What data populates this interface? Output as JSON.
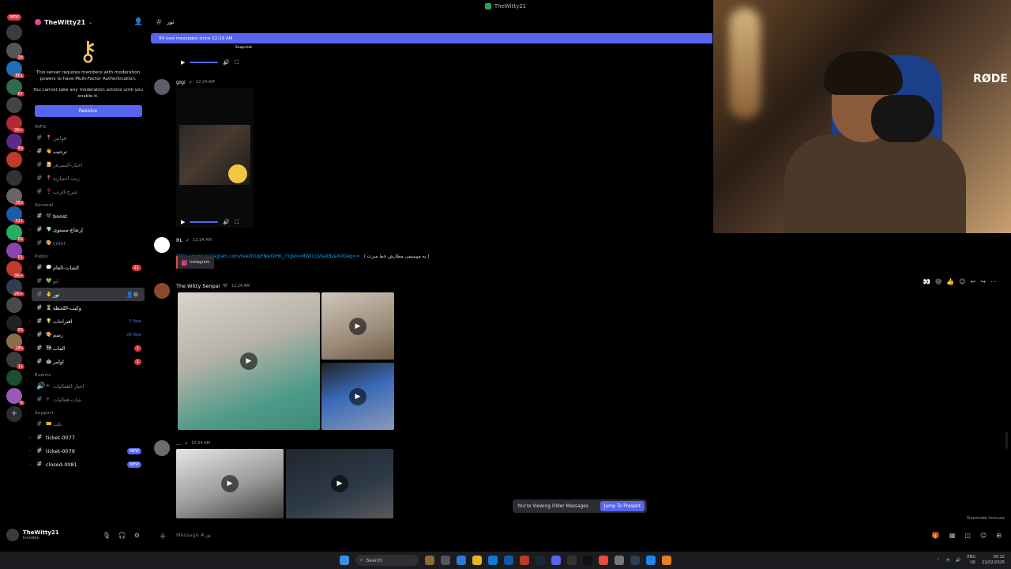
{
  "window": {
    "title": "TheWitty21"
  },
  "rail": {
    "new_label": "NEW",
    "badges": [
      "18",
      "861",
      "67",
      "3K+",
      "89",
      "383",
      "321",
      "83",
      "51",
      "9K+",
      "2K+",
      "55",
      "185",
      "12",
      "6"
    ]
  },
  "server": {
    "name": "TheWitty21",
    "mfa_text_1": "This server requires members with moderation powers to have Multi-Factor Authentication.",
    "mfa_text_2": "You cannot take any moderation actions until you enable it.",
    "resolve_label": "Resolve"
  },
  "categories": {
    "info": "INFO",
    "general": "General",
    "public": "Public",
    "events": "Events",
    "support": "Support"
  },
  "channels": {
    "info": [
      {
        "name": "قوانين",
        "emoji": "📍"
      },
      {
        "name": "ترحيب",
        "emoji": "👋"
      },
      {
        "name": "اخبار-السيرفر",
        "emoji": "📔"
      },
      {
        "name": "رتب-اختيارية",
        "emoji": "📍"
      },
      {
        "name": "شرح-الرتب",
        "emoji": "❓"
      }
    ],
    "general": [
      {
        "name": "boost",
        "emoji": "🖤"
      },
      {
        "name": "إرتفاع-مستوى",
        "emoji": "💎"
      },
      {
        "name": "color",
        "emoji": "🎨"
      }
    ],
    "public": [
      {
        "name": "الشات-العام",
        "emoji": "💬",
        "count": "21"
      },
      {
        "name": "ابو",
        "emoji": "💚"
      },
      {
        "name": "ثور",
        "emoji": "🤚"
      },
      {
        "name": "وكيب-اللحظة",
        "emoji": "⏳"
      },
      {
        "name": "اقتراحات",
        "emoji": "💡",
        "tag": "5 New"
      },
      {
        "name": "رسم",
        "emoji": "🎨",
        "tag": "26 New"
      },
      {
        "name": "الماب",
        "emoji": "🗺",
        "count": "1"
      },
      {
        "name": "اوامر",
        "emoji": "🤖",
        "count": "1"
      }
    ],
    "events": [
      {
        "name": "اخبار-الفعاليات",
        "emoji": "✳"
      },
      {
        "name": "شات-فعاليات",
        "emoji": "✳"
      }
    ],
    "support": [
      {
        "name": "تكت",
        "emoji": "🎫"
      },
      {
        "name": "ticket-0077"
      },
      {
        "name": "ticket-0079",
        "new": "NEW"
      },
      {
        "name": "closed-0081",
        "new": "NEW"
      }
    ]
  },
  "user": {
    "name": "TheWitty21",
    "status": "Invisible"
  },
  "chat": {
    "channel_name": "ثور",
    "new_messages": "99 new messages since 12:19 AM",
    "messages": [
      {
        "author": "gigi",
        "time": "12:24 AM"
      },
      {
        "author": "RL",
        "time": "12:24 AM",
        "link": "https://www.instagram.com/reel/DUpFNwOiHh_/?igsh=MWI1cjVlaXBzeXVOeg==",
        "link_tail": "( يه موسيقى مطارش حط ميزت )",
        "embed": "Instagram"
      },
      {
        "author": "The Witty Senpai",
        "time": "12:24 AM"
      },
      {
        "author": "...",
        "time": "12:24 AM"
      }
    ],
    "snapchat_label": "Snapchat",
    "viewing_older": "You're Viewing Older Messages",
    "jump_label": "Jump To Present",
    "slowmode": "Slowmode Immune",
    "placeholder": "Message #ثور"
  },
  "taskbar": {
    "search": "Search",
    "lang": "ENG",
    "region": "UK",
    "time": "00:32",
    "date": "21/02/2026"
  },
  "cam": {
    "brand": "RØDE"
  },
  "colors": {
    "accent": "#5865f2",
    "danger": "#da373c",
    "online": "#23a55a"
  }
}
